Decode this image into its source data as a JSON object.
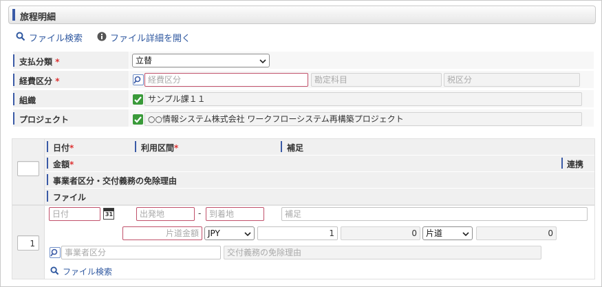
{
  "title": "旅程明細",
  "toolbar": {
    "file_search": "ファイル検索",
    "file_details": "ファイル詳細を開く"
  },
  "form": {
    "payment_type": {
      "label": "支払分類",
      "required_mark": "*",
      "value": "立替"
    },
    "expense_category": {
      "label": "経費区分",
      "required_mark": "*",
      "placeholder": "経費区分",
      "account_placeholder": "勘定科目",
      "tax_placeholder": "税区分"
    },
    "organization": {
      "label": "組織",
      "value": "サンプル課１１"
    },
    "project": {
      "label": "プロジェクト",
      "value": "○○情報システム株式会社 ワークフローシステム再構築プロジェクト"
    }
  },
  "grid": {
    "headers": {
      "date": "日付",
      "route": "利用区間",
      "note": "補足",
      "amount": "金額",
      "link": "連携",
      "exemption": "事業者区分・交付義務の免除理由",
      "file": "ファイル"
    },
    "required_mark": "*",
    "row": {
      "number": "1",
      "date_placeholder": "日付",
      "calendar_day": "31",
      "departure_placeholder": "出発地",
      "dash": "-",
      "arrival_placeholder": "到着地",
      "note_placeholder": "補足",
      "oneway_amount_placeholder": "片道金額",
      "currency": "JPY",
      "rate": "1",
      "converted": "0",
      "trip_type": "片道",
      "total": "0",
      "business_type_placeholder": "事業者区分",
      "exemption_placeholder": "交付義務の免除理由",
      "file_search": "ファイル検索"
    }
  },
  "colors": {
    "accent": "#3a5aa6",
    "link": "#2f58a0",
    "required": "#dd3333",
    "check": "#3a9a3a",
    "error_border": "#c0506a"
  }
}
